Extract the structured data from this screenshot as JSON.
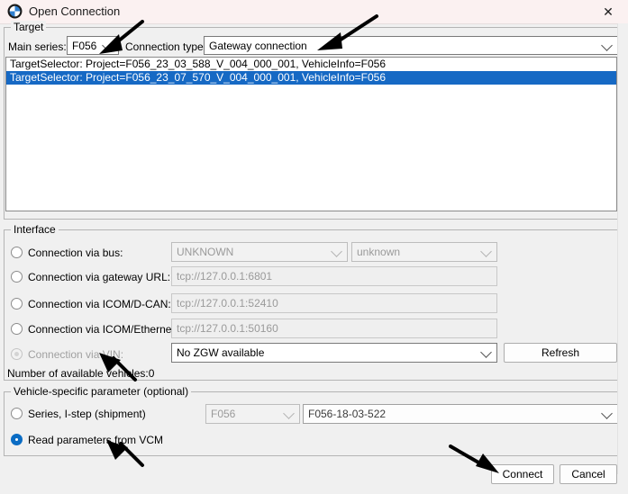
{
  "window": {
    "title": "Open Connection",
    "logo_icon": "bmw-roundel-icon",
    "close_icon": "close-icon"
  },
  "target": {
    "legend": "Target",
    "main_series_label": "Main series:",
    "main_series_value": "F056",
    "connection_type_label": "Connection type:",
    "connection_type_value": "Gateway connection",
    "list_items": [
      {
        "text": "TargetSelector: Project=F056_23_03_588_V_004_000_001, VehicleInfo=F056",
        "selected": false
      },
      {
        "text": "TargetSelector: Project=F056_23_07_570_V_004_000_001, VehicleInfo=F056",
        "selected": true
      }
    ]
  },
  "interface": {
    "legend": "Interface",
    "rows": [
      {
        "label": "Connection via bus:",
        "selected": false,
        "disabled": false,
        "value": "UNKNOWN",
        "value2": "unknown"
      },
      {
        "label": "Connection via gateway URL:",
        "selected": false,
        "disabled": false,
        "value": "tcp://127.0.0.1:6801"
      },
      {
        "label": "Connection via ICOM/D-CAN:",
        "selected": false,
        "disabled": false,
        "value": "tcp://127.0.0.1:52410"
      },
      {
        "label": "Connection via ICOM/Ethernet:",
        "selected": false,
        "disabled": false,
        "value": "tcp://127.0.0.1:50160"
      },
      {
        "label": "Connection via VIN:",
        "selected": false,
        "disabled": true,
        "value": "No ZGW available"
      }
    ],
    "refresh_label": "Refresh",
    "vehicle_count_text": "Number of available vehicles:0"
  },
  "vehicle_params": {
    "legend": "Vehicle-specific parameter (optional)",
    "series_istep_label": "Series, I-step (shipment)",
    "series_istep_selected": false,
    "series_value": "F056",
    "istep_value": "F056-18-03-522",
    "read_vcm_label": "Read parameters from VCM",
    "read_vcm_selected": true
  },
  "footer": {
    "connect_label": "Connect",
    "cancel_label": "Cancel"
  },
  "colors": {
    "selection_blue": "#1669c4",
    "radio_blue": "#0a6cc4",
    "titlebar": "#fbf1f1",
    "dialog_bg": "#f0f0f0"
  }
}
